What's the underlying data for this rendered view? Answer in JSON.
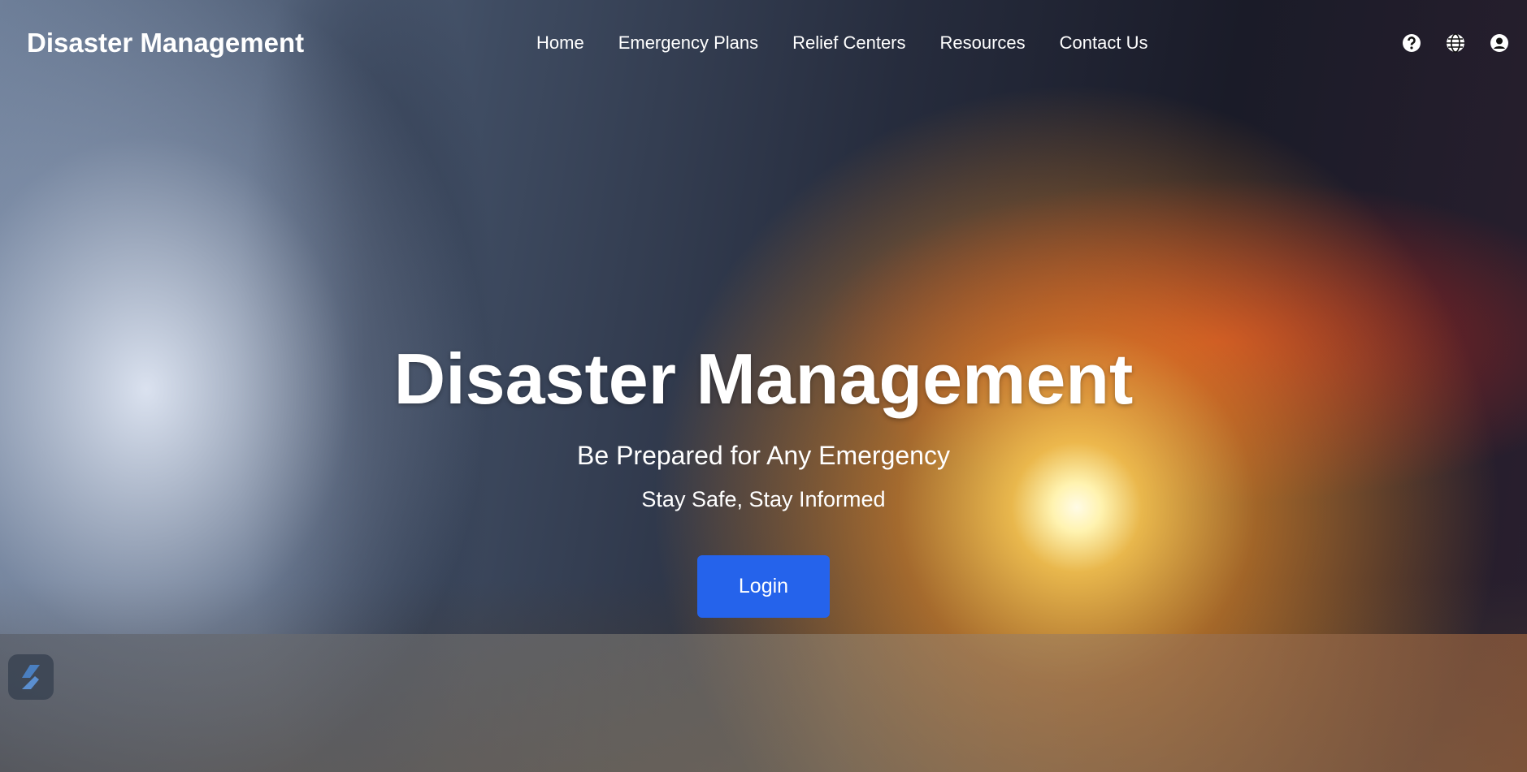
{
  "nav": {
    "brand": "Disaster Management",
    "links": [
      "Home",
      "Emergency Plans",
      "Relief Centers",
      "Resources",
      "Contact Us"
    ],
    "icons": [
      "help-circle-icon",
      "globe-icon",
      "user-circle-icon"
    ]
  },
  "hero": {
    "title": "Disaster Management",
    "subtitle": "Be Prepared for Any Emergency",
    "tagline": "Stay Safe, Stay Informed",
    "login_label": "Login"
  },
  "colors": {
    "accent": "#2563eb"
  }
}
